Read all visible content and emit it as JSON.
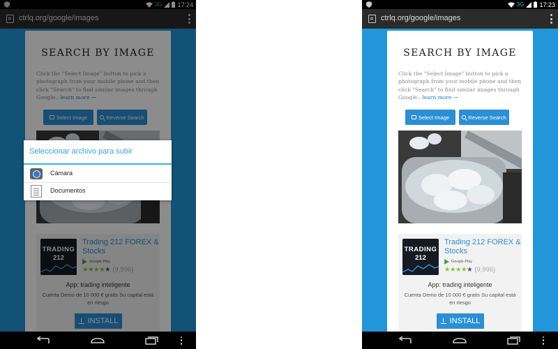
{
  "status_bar": {
    "network": "3G",
    "time_left": "17:24",
    "time_right": "17:23"
  },
  "browser": {
    "url": "ctrlq.org/google/images"
  },
  "page": {
    "title": "SEARCH BY IMAGE",
    "intro": "Click the \"Select Image\" button to pick a photograph from your mobile phone and then click \"Search\" to find similar images through Google..",
    "learn_more": "learn more →",
    "select_button": "Select Image",
    "reverse_button": "Reverse Search"
  },
  "ad": {
    "logo_line1": "TRADING",
    "logo_line2": "212",
    "title": "Trading 212 FOREX & Stocks",
    "store": "Google Play",
    "stars": "★★★★",
    "half_star": "★",
    "rating_count": "(9,996)",
    "app_line": "App: trading inteligente",
    "description": "Cuenta Demo de 10 000 € gratis Su capital está en riesgo",
    "install_label": "INSTALL"
  },
  "dialog": {
    "title": "Seleccionar archivo para subir",
    "options": [
      {
        "label": "Cámara",
        "icon": "camera-icon"
      },
      {
        "label": "Documentos",
        "icon": "documents-icon"
      }
    ]
  },
  "colors": {
    "page_background": "#2196d8",
    "accent": "#2b8fd6",
    "dialog_accent": "#33b5e5"
  }
}
